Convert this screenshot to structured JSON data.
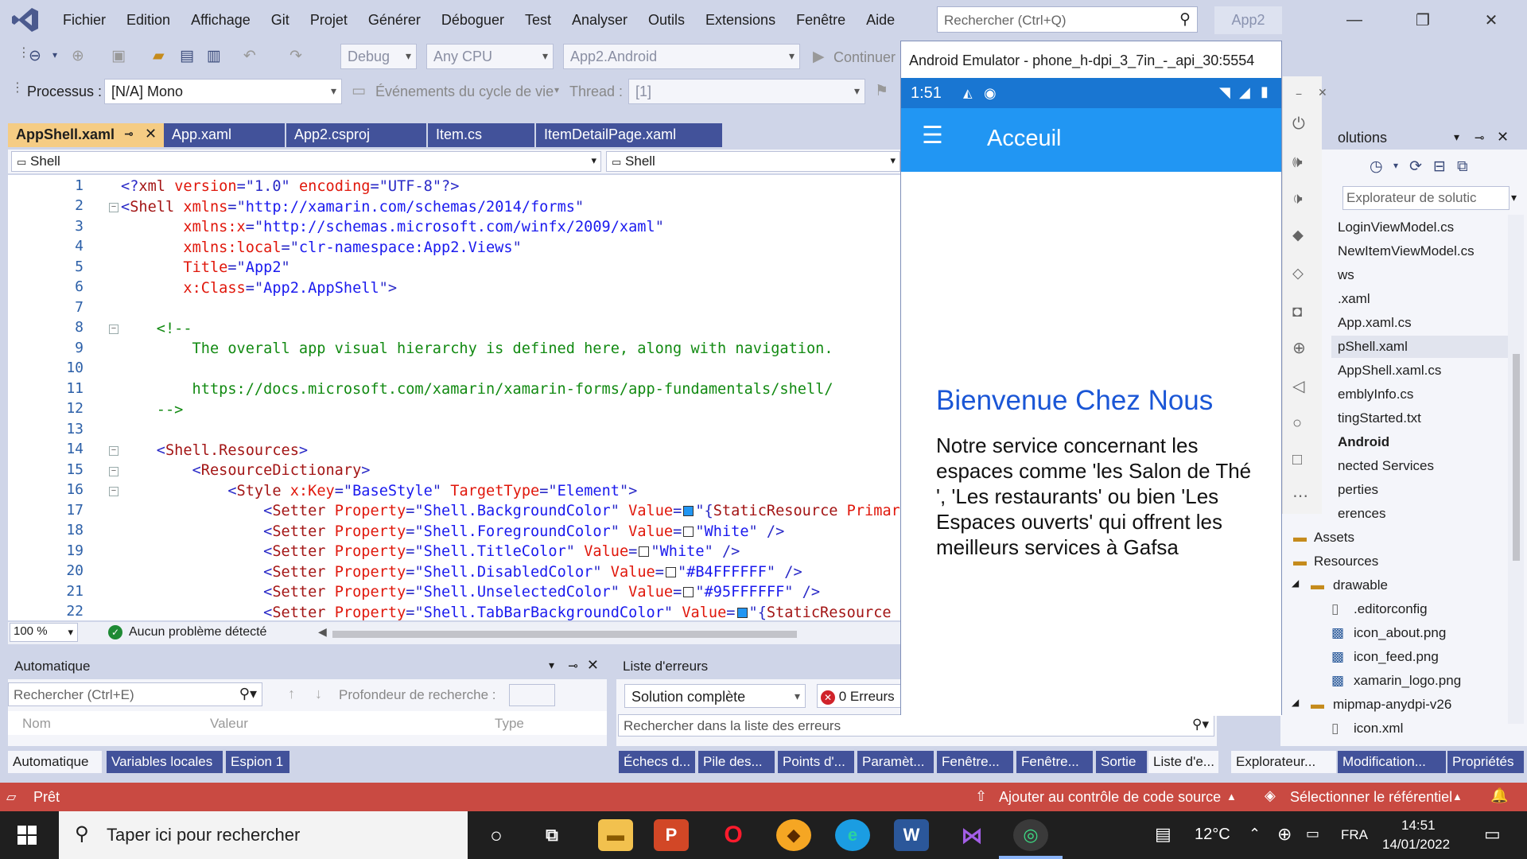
{
  "menubar": {
    "items": [
      "Fichier",
      "Edition",
      "Affichage",
      "Git",
      "Projet",
      "Générer",
      "Déboguer",
      "Test",
      "Analyser",
      "Outils",
      "Extensions",
      "Fenêtre",
      "Aide"
    ],
    "search_placeholder": "Rechercher (Ctrl+Q)",
    "app_name": "App2"
  },
  "toolbar": {
    "config": "Debug",
    "platform": "Any CPU",
    "project": "App2.Android",
    "continue_label": "Continuer",
    "process_label": "Processus :",
    "process_value": "[N/A] Mono",
    "lifecycle_label": "Événements du cycle de vie",
    "thread_label": "Thread :",
    "thread_value": "[1]"
  },
  "tabs": [
    "AppShell.xaml",
    "App.xaml",
    "App2.csproj",
    "Item.cs",
    "ItemDetailPage.xaml"
  ],
  "navbar": {
    "left": "Shell",
    "right": "Shell"
  },
  "editor": {
    "line_numbers": [
      "1",
      "2",
      "3",
      "4",
      "5",
      "6",
      "7",
      "8",
      "9",
      "10",
      "11",
      "12",
      "13",
      "14",
      "15",
      "16",
      "17",
      "18",
      "19",
      "20",
      "21",
      "22"
    ],
    "zoom": "100 %",
    "status": "Aucun problème détecté"
  },
  "autos": {
    "title": "Automatique",
    "search_placeholder": "Rechercher (Ctrl+E)",
    "depth_label": "Profondeur de recherche :",
    "columns": [
      "Nom",
      "Valeur",
      "Type"
    ],
    "tabs": [
      "Automatique",
      "Variables locales",
      "Espion 1"
    ]
  },
  "errors": {
    "title": "Liste d'erreurs",
    "scope": "Solution complète",
    "errors_badge": "0 Erreurs",
    "search_placeholder": "Rechercher dans la liste des erreurs",
    "tabs": [
      "Échecs d...",
      "Pile des...",
      "Points d'...",
      "Paramèt...",
      "Fenêtre...",
      "Fenêtre...",
      "Sortie",
      "Liste d'e..."
    ]
  },
  "solution": {
    "title": "olutions",
    "search_placeholder": "Explorateur de solutic",
    "items": [
      "LoginViewModel.cs",
      "NewItemViewModel.cs",
      "ws",
      ".xaml",
      "App.xaml.cs",
      "pShell.xaml",
      "AppShell.xaml.cs",
      "emblyInfo.cs",
      "tingStarted.txt",
      "Android",
      "nected Services",
      "perties",
      "erences",
      "Assets",
      "Resources",
      "drawable",
      ".editorconfig",
      "icon_about.png",
      "icon_feed.png",
      "xamarin_logo.png",
      "mipmap-anydpi-v26",
      "icon.xml"
    ],
    "bottom_tabs": [
      "Explorateur...",
      "Modification...",
      "Propriétés"
    ]
  },
  "emulator": {
    "title": "Android Emulator - phone_h-dpi_3_7in_-_api_30:5554",
    "time": "1:51",
    "app_title": "Acceuil",
    "heading": "Bienvenue Chez Nous",
    "body": "Notre service concernant les espaces  comme 'les Salon de Thé ', 'Les restaurants' ou bien 'Les Espaces ouverts' qui offrent les meilleurs services à Gafsa"
  },
  "status": {
    "ready": "Prêt",
    "source_control": "Ajouter au contrôle de code source",
    "repo": "Sélectionner le référentiel"
  },
  "taskbar": {
    "search": "Taper ici pour rechercher",
    "temp": "12°C",
    "lang": "FRA",
    "time": "14:51",
    "date": "14/01/2022"
  },
  "colors": {
    "accent": "#42529a",
    "status": "#c94a42",
    "android_bar": "#2196f3",
    "heading": "#1a56d6"
  }
}
